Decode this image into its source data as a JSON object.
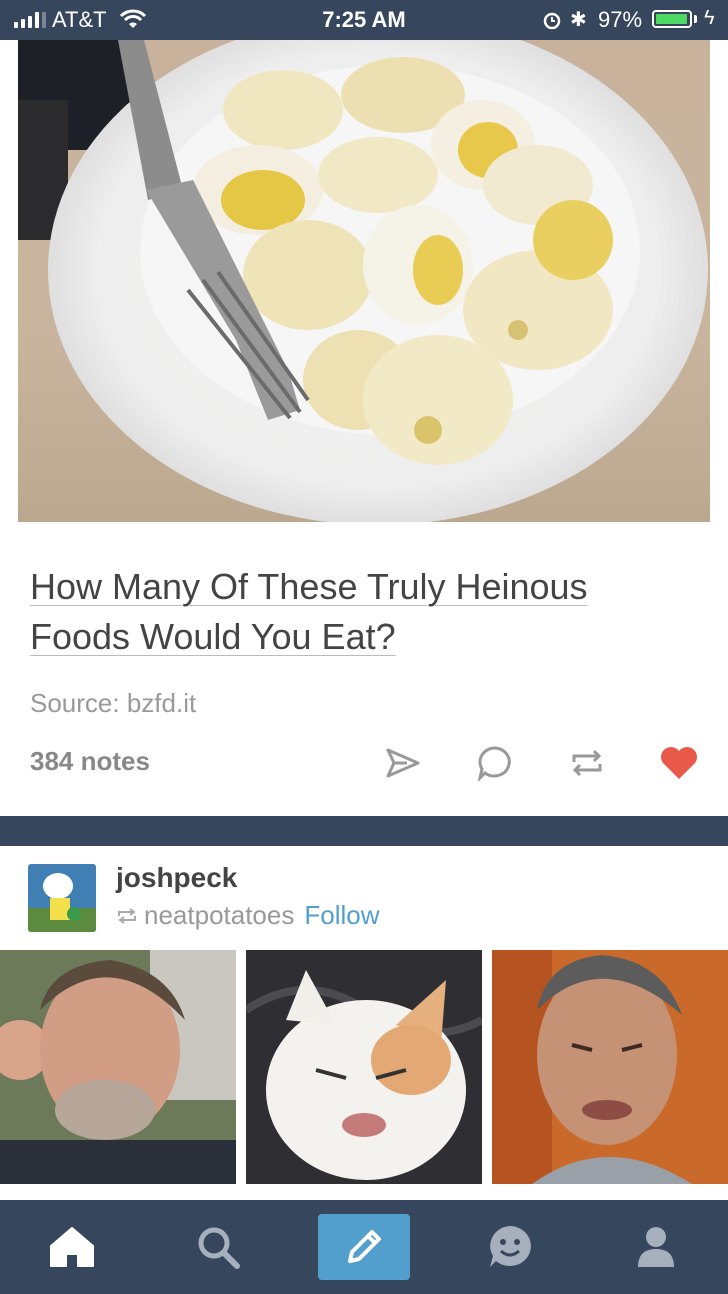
{
  "status_bar": {
    "carrier": "AT&T",
    "time": "7:25 AM",
    "battery_percent": "97%",
    "battery_level": 0.97,
    "icons": [
      "signal-icon",
      "wifi-icon",
      "alarm-icon",
      "bluetooth-icon",
      "battery-icon",
      "charging-icon"
    ]
  },
  "post1": {
    "title_line1": "How Many Of These Truly Heinous",
    "title_line2": "Foods Would You Eat?",
    "source": "Source: bzfd.it",
    "notes": "384 notes",
    "like_color": "#e8594a",
    "actions": [
      "share-icon",
      "reply-icon",
      "reblog-icon",
      "like-heart-icon"
    ]
  },
  "post2": {
    "username": "joshpeck",
    "reblogged_from": "neatpotatoes",
    "follow_label": "Follow",
    "follow_color": "#529ecc"
  },
  "tab_bar": {
    "tabs": [
      "home-icon",
      "search-icon",
      "compose-icon",
      "activity-icon",
      "account-icon"
    ],
    "compose_color": "#529ecc",
    "bar_color": "#36465d"
  }
}
